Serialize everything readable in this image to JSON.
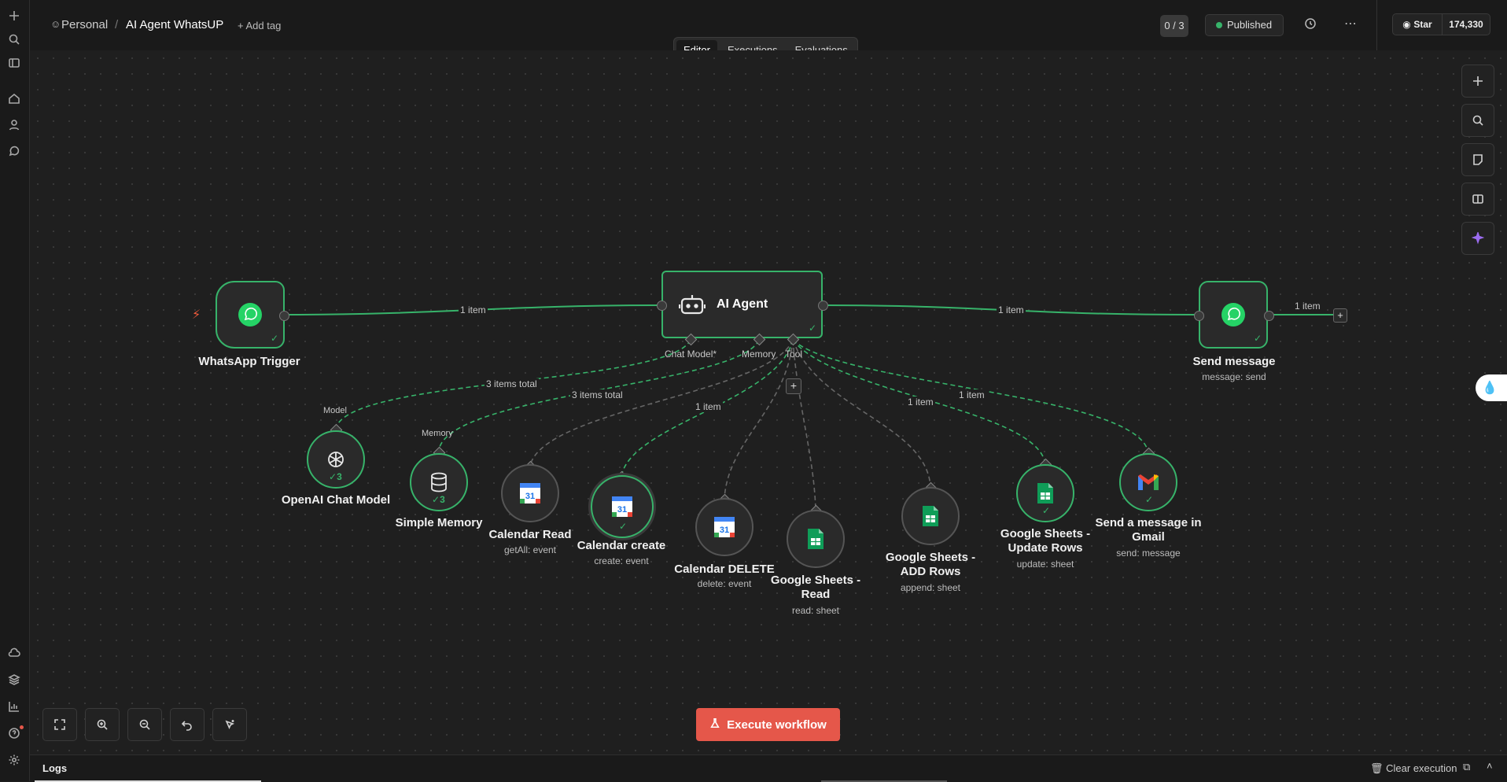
{
  "header": {
    "project": "Personal",
    "separator": "/",
    "workflow_name": "AI Agent WhatsUP",
    "add_tag": "+ Add tag",
    "counter": "0 / 3",
    "status": "Published",
    "star_label": "Star",
    "star_count": "174,330"
  },
  "tabs": [
    "Editor",
    "Executions",
    "Evaluations"
  ],
  "nodes": {
    "trigger": {
      "label": "WhatsApp Trigger"
    },
    "agent": {
      "label": "AI Agent",
      "port_chat": "Chat Model*",
      "port_memory": "Memory",
      "port_tool": "Tool"
    },
    "send": {
      "label": "Send message",
      "sub": "message: send"
    },
    "openai": {
      "label": "OpenAI Chat Model",
      "port": "Model",
      "count": "3"
    },
    "memory": {
      "label": "Simple Memory",
      "port": "Memory",
      "count": "3"
    },
    "cal_read": {
      "label": "Calendar Read",
      "sub": "getAll: event"
    },
    "cal_create": {
      "label": "Calendar create",
      "sub": "create: event"
    },
    "cal_delete": {
      "label": "Calendar DELETE",
      "sub": "delete: event"
    },
    "gs_read": {
      "label_1": "Google Sheets -",
      "label_2": "Read",
      "sub": "read: sheet"
    },
    "gs_add": {
      "label_1": "Google Sheets -",
      "label_2": "ADD Rows",
      "sub": "append: sheet"
    },
    "gs_update": {
      "label_1": "Google Sheets -",
      "label_2": "Update Rows",
      "sub": "update: sheet"
    },
    "gmail": {
      "label_1": "Send a message in",
      "label_2": "Gmail",
      "sub": "send: message"
    }
  },
  "edges": {
    "trigger_agent": "1 item",
    "agent_send": "1 item",
    "send_out": "1 item",
    "openai": "3 items total",
    "memory": "3 items total",
    "cal_create": "1 item",
    "gs_add": "1 item",
    "gs_update": "1 item"
  },
  "execute_button": "Execute workflow",
  "logs": {
    "title": "Logs",
    "clear": "Clear execution"
  },
  "colors": {
    "success": "#37b36a",
    "execute": "#e5574a",
    "ai": "#9b6cf0"
  }
}
